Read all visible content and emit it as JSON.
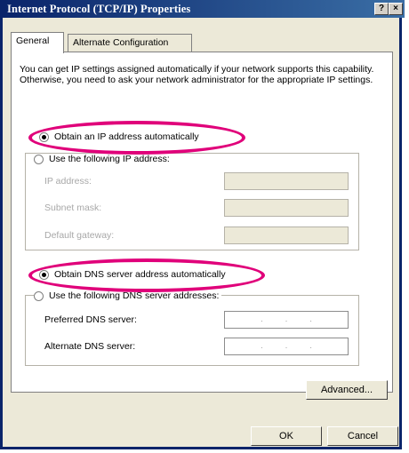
{
  "window": {
    "title": "Internet Protocol (TCP/IP) Properties",
    "help_label": "?",
    "close_label": "×"
  },
  "tabs": [
    {
      "label": "General",
      "active": true
    },
    {
      "label": "Alternate Configuration",
      "active": false
    }
  ],
  "description": "You can get IP settings assigned automatically if your network supports this capability. Otherwise, you need to ask your network administrator for the appropriate IP settings.",
  "ip_section": {
    "auto_label": "Obtain an IP address automatically",
    "manual_label": "Use the following IP address:",
    "auto_selected": true,
    "fields": [
      {
        "label": "IP address:"
      },
      {
        "label": "Subnet mask:"
      },
      {
        "label": "Default gateway:"
      }
    ]
  },
  "dns_section": {
    "auto_label": "Obtain DNS server address automatically",
    "manual_label": "Use the following DNS server addresses:",
    "auto_selected": true,
    "fields": [
      {
        "label": "Preferred DNS server:"
      },
      {
        "label": "Alternate DNS server:"
      }
    ]
  },
  "buttons": {
    "advanced": "Advanced...",
    "ok": "OK",
    "cancel": "Cancel"
  },
  "colors": {
    "highlight": "#e0007a",
    "titlebar": "#0a246a"
  }
}
